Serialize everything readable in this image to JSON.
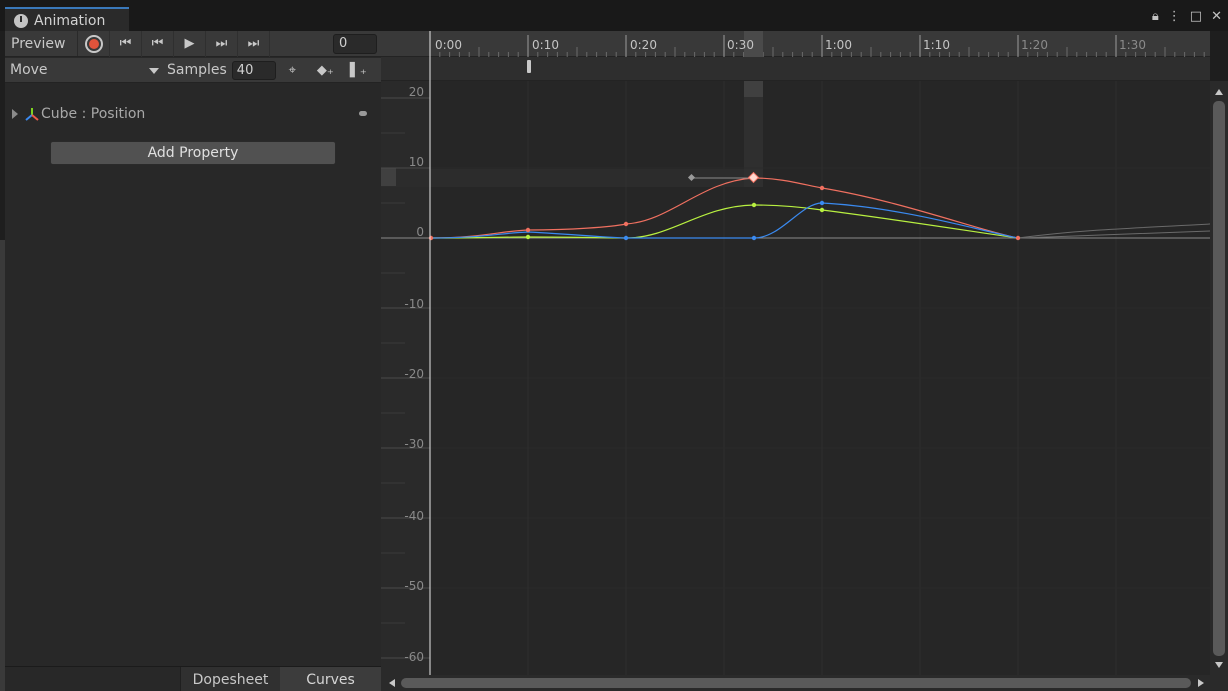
{
  "window": {
    "tab_title": "Animation",
    "controls": [
      "lock-icon",
      "more-icon",
      "maximize-icon",
      "close-icon"
    ]
  },
  "toolbar": {
    "preview_label": "Preview",
    "frame_value": "0",
    "buttons": [
      "record-icon",
      "first-key-icon",
      "prev-key-icon",
      "play-icon",
      "next-key-icon",
      "last-key-icon"
    ]
  },
  "clip": {
    "name": "Move",
    "samples_label": "Samples",
    "samples_value": "40"
  },
  "property": {
    "label": "Cube : Position"
  },
  "add_property_label": "Add Property",
  "bottom_tabs": {
    "dopesheet": "Dopesheet",
    "curves": "Curves"
  },
  "timeline": {
    "ticks": [
      "0:00",
      "0:10",
      "0:20",
      "0:30",
      "1:00",
      "1:10",
      "1:20",
      "1:30"
    ]
  },
  "curve_editor": {
    "y_ticks": [
      "20",
      "10",
      "0",
      "-10",
      "-20",
      "-30",
      "-40",
      "-50",
      "-60"
    ],
    "colors": {
      "x_curve": "#f07060",
      "y_curve": "#b8f040",
      "z_curve": "#3a8af0"
    }
  }
}
